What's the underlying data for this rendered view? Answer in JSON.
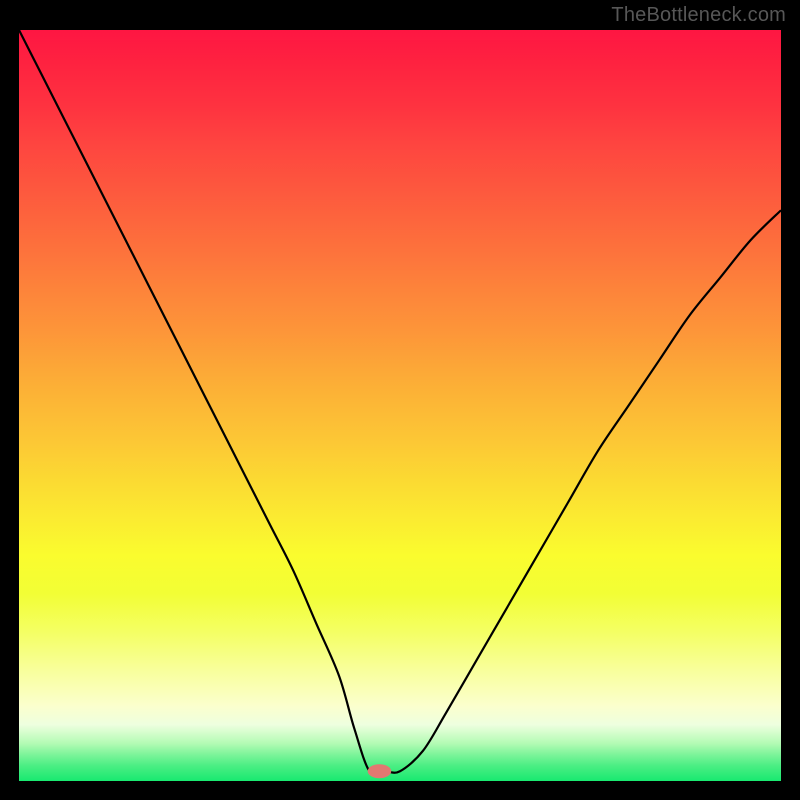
{
  "watermark": "TheBottleneck.com",
  "colors": {
    "bg": "#000000",
    "watermark": "#575757",
    "curve": "#000000",
    "marker_fill": "#e17871",
    "gradient_stops": [
      {
        "offset": 0.0,
        "color": "#fe1642"
      },
      {
        "offset": 0.05,
        "color": "#fe2440"
      },
      {
        "offset": 0.1,
        "color": "#fe3240"
      },
      {
        "offset": 0.15,
        "color": "#fe4440"
      },
      {
        "offset": 0.2,
        "color": "#fd543e"
      },
      {
        "offset": 0.25,
        "color": "#fd643d"
      },
      {
        "offset": 0.3,
        "color": "#fd743c"
      },
      {
        "offset": 0.35,
        "color": "#fd853a"
      },
      {
        "offset": 0.4,
        "color": "#fd9539"
      },
      {
        "offset": 0.45,
        "color": "#fca737"
      },
      {
        "offset": 0.5,
        "color": "#fcb836"
      },
      {
        "offset": 0.55,
        "color": "#fcc835"
      },
      {
        "offset": 0.6,
        "color": "#fbda32"
      },
      {
        "offset": 0.65,
        "color": "#fbeb31"
      },
      {
        "offset": 0.7,
        "color": "#fafc2e"
      },
      {
        "offset": 0.75,
        "color": "#f2fe35"
      },
      {
        "offset": 0.8,
        "color": "#f4ff62"
      },
      {
        "offset": 0.85,
        "color": "#f8ff99"
      },
      {
        "offset": 0.9,
        "color": "#fbffcd"
      },
      {
        "offset": 0.925,
        "color": "#eeffdf"
      },
      {
        "offset": 0.95,
        "color": "#b3fbb4"
      },
      {
        "offset": 0.965,
        "color": "#7cf499"
      },
      {
        "offset": 0.98,
        "color": "#4aee83"
      },
      {
        "offset": 1.0,
        "color": "#18e970"
      }
    ]
  },
  "chart_data": {
    "type": "line",
    "title": "",
    "xlabel": "",
    "ylabel": "",
    "x_range": [
      0,
      100
    ],
    "y_range": [
      0,
      100
    ],
    "note": "x and y are in percent of plot-area width/height; y=0 is bottom (green), y=100 is top (red). Curve shows bottleneck percentage; minimum near x≈47.",
    "series": [
      {
        "name": "bottleneck-curve",
        "x": [
          0,
          3,
          6,
          9,
          12,
          15,
          18,
          21,
          24,
          27,
          30,
          33,
          36,
          39,
          42,
          44,
          46,
          48,
          50,
          53,
          56,
          60,
          64,
          68,
          72,
          76,
          80,
          84,
          88,
          92,
          96,
          100
        ],
        "y": [
          100,
          94,
          88,
          82,
          76,
          70,
          64,
          58,
          52,
          46,
          40,
          34,
          28,
          21,
          14,
          7,
          1.3,
          1.3,
          1.3,
          4,
          9,
          16,
          23,
          30,
          37,
          44,
          50,
          56,
          62,
          67,
          72,
          76
        ]
      }
    ],
    "marker": {
      "x": 47.3,
      "y": 1.3,
      "rx_pct": 1.55,
      "ry_pct": 0.93
    }
  }
}
